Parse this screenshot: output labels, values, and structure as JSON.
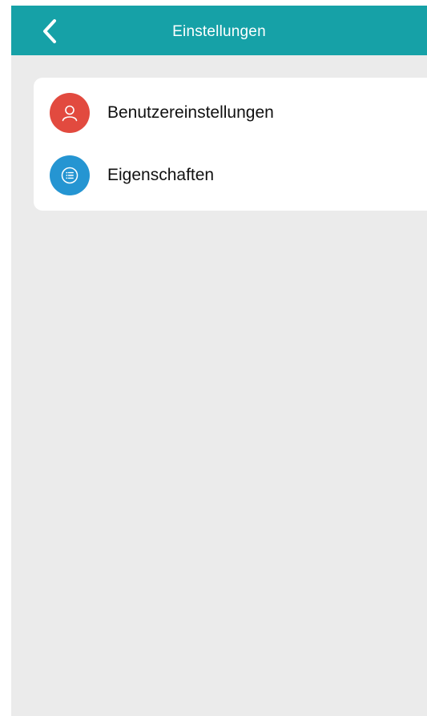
{
  "header": {
    "title": "Einstellungen",
    "back_icon": "chevron-left-icon"
  },
  "settings": {
    "items": [
      {
        "label": "Benutzereinstellungen",
        "icon": "user-icon",
        "icon_color": "#e24a3f",
        "trail": "2"
      },
      {
        "label": "Eigenschaften",
        "icon": "list-icon",
        "icon_color": "#2595d2",
        "trail": "2"
      }
    ]
  },
  "colors": {
    "navbar": "#16a1a7",
    "background": "#ebebeb",
    "card": "#ffffff"
  }
}
